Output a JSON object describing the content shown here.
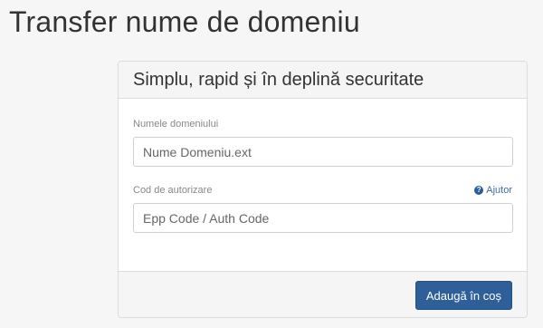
{
  "page": {
    "title": "Transfer nume de domeniu"
  },
  "panel": {
    "heading": "Simplu, rapid și în deplină securitate",
    "domain_field": {
      "label": "Numele domeniului",
      "placeholder": "Nume Domeniu.ext",
      "value": ""
    },
    "auth_field": {
      "label": "Cod de autorizare",
      "help_label": "Ajutor",
      "help_icon": "question-circle-icon",
      "placeholder": "Epp Code / Auth Code",
      "value": ""
    },
    "submit_label": "Adaugă în coș"
  },
  "colors": {
    "background": "#f6f6f6",
    "primary_button": "#2e5f99",
    "help_link": "#3a6ea5"
  }
}
